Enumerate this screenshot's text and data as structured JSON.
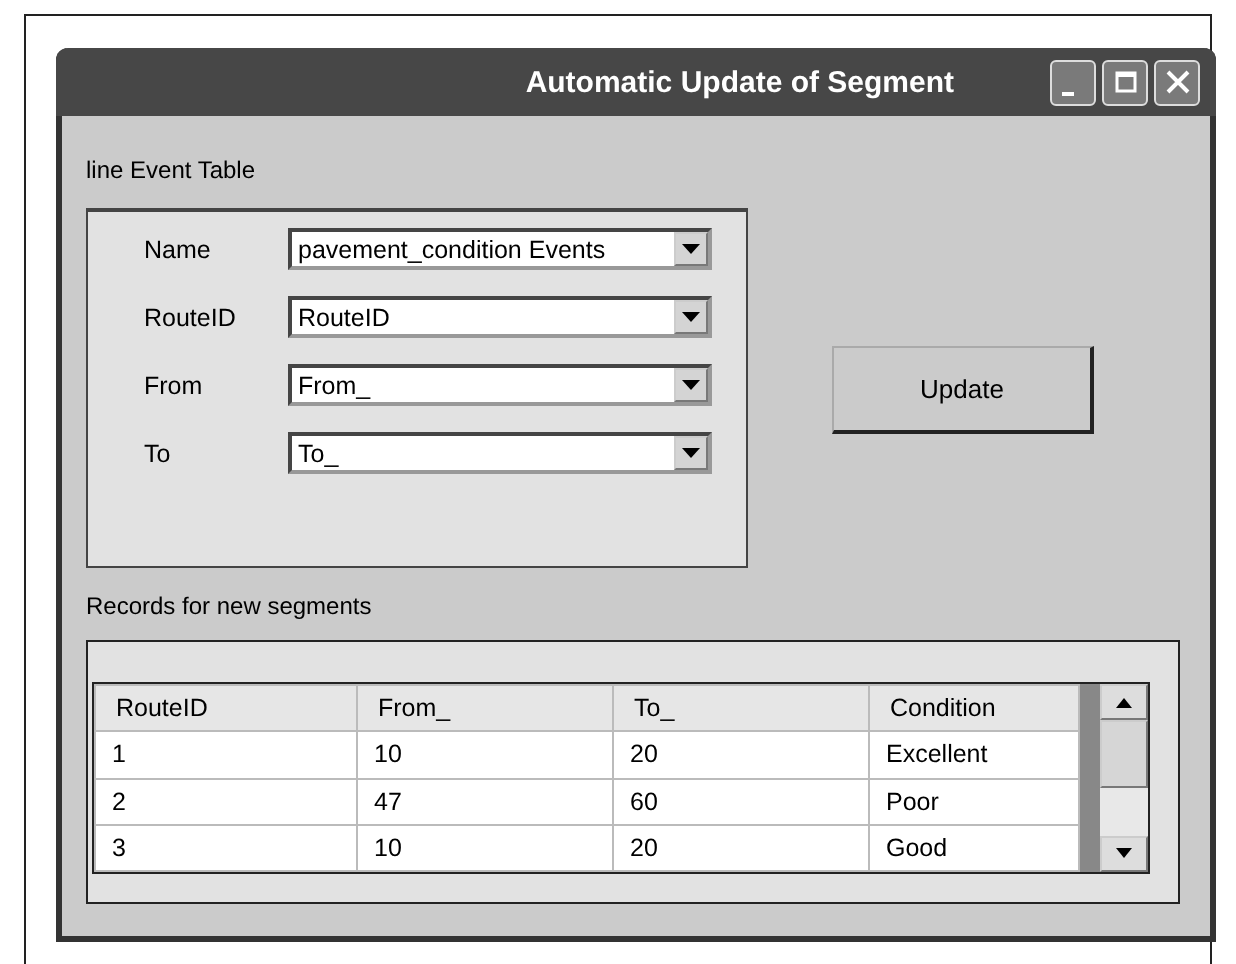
{
  "window": {
    "title": "Automatic Update of Segment"
  },
  "event_table": {
    "label": "line Event Table",
    "fields": [
      {
        "label": "Name",
        "value": "pavement_condition Events"
      },
      {
        "label": "RouteID",
        "value": "RouteID"
      },
      {
        "label": "From",
        "value": "From_"
      },
      {
        "label": "To",
        "value": "To_"
      }
    ]
  },
  "update_button": "Update",
  "records": {
    "label": "Records for new segments",
    "columns": [
      "RouteID",
      "From_",
      "To_",
      "Condition"
    ],
    "rows": [
      [
        "1",
        "10",
        "20",
        "Excellent"
      ],
      [
        "2",
        "47",
        "60",
        "Poor"
      ],
      [
        "3",
        "10",
        "20",
        "Good"
      ]
    ]
  }
}
